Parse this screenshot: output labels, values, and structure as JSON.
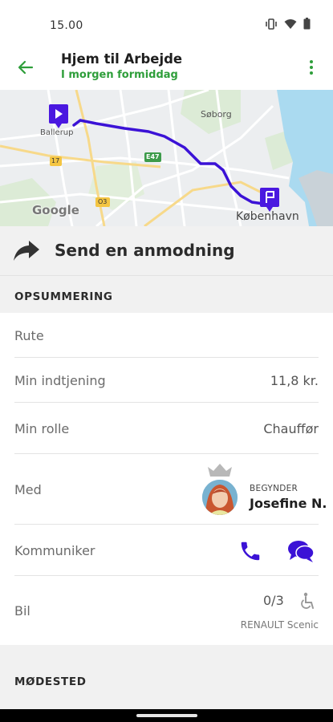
{
  "status_bar": {
    "time": "15.00"
  },
  "header": {
    "title": "Hjem til Arbejde",
    "subtitle": "I morgen formiddag"
  },
  "map": {
    "labels": {
      "ballerup": "Ballerup",
      "soborg": "Søborg",
      "kobenhavn": "København",
      "road_17": "17",
      "road_e47": "E47",
      "road_o3": "O3",
      "google": "Google"
    }
  },
  "request": {
    "label": "Send en anmodning"
  },
  "summary": {
    "title": "OPSUMMERING",
    "rows": {
      "route": {
        "label": "Rute"
      },
      "earnings": {
        "label": "Min indtjening",
        "value": "11,8 kr."
      },
      "role": {
        "label": "Min rolle",
        "value": "Chauffør"
      },
      "with": {
        "label": "Med",
        "level": "BEGYNDER",
        "name": "Josefine N."
      },
      "communicate": {
        "label": "Kommuniker"
      },
      "car": {
        "label": "Bil",
        "seats": "0/3",
        "model": "RENAULT Scenic"
      }
    }
  },
  "meeting": {
    "title": "MØDESTED"
  },
  "colors": {
    "accent_green": "#2e9e3a",
    "accent_purple": "#3b12d6",
    "route_line": "#3b12d6",
    "background_gray": "#f1f1f1"
  },
  "icons": {
    "back": "arrow-left-icon",
    "menu": "more-vert-icon",
    "request": "share-arrow-icon",
    "phone": "phone-icon",
    "chat": "chat-icon",
    "wheelchair": "wheelchair-icon",
    "crown": "crown-icon"
  }
}
